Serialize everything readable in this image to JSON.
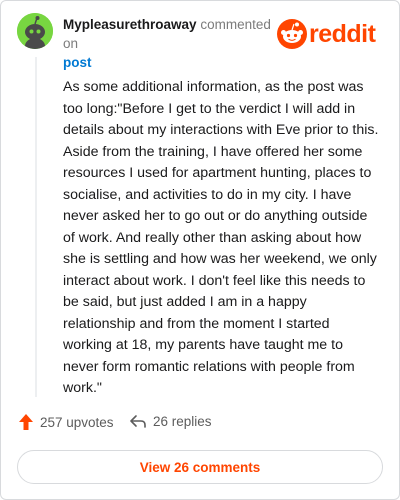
{
  "comment": {
    "username": "Mypleasurethroaway",
    "action_text": "commented on",
    "post_link": "post",
    "body": "As some additional information, as the post was too long:\"Before I get to the verdict I will add in details about my interactions with Eve prior to this. Aside from the training, I have offered her some resources I used for apartment hunting, places to socialise, and activities to do in my city. I have never asked her to go out or do anything outside of work. And really other than asking about how she is settling and how was her weekend, we only interact about work. I don't feel like this needs to be said, but just added I am in a happy relationship and from the moment I started working at 18, my parents have taught me to never form romantic relations with people from work.\"",
    "upvotes": "257 upvotes",
    "replies": "26 replies"
  },
  "brand": {
    "wordmark": "reddit",
    "color": "#ff4500"
  },
  "footer": {
    "view_comments_label": "View 26 comments"
  },
  "icons": {
    "avatar": "snoo-avatar-icon",
    "logo": "reddit-logo-icon",
    "upvote": "upvote-arrow-icon",
    "reply": "reply-arrow-icon"
  },
  "colors": {
    "avatar_bg": "#78d641",
    "link": "#0079d3",
    "accent": "#ff4500"
  }
}
